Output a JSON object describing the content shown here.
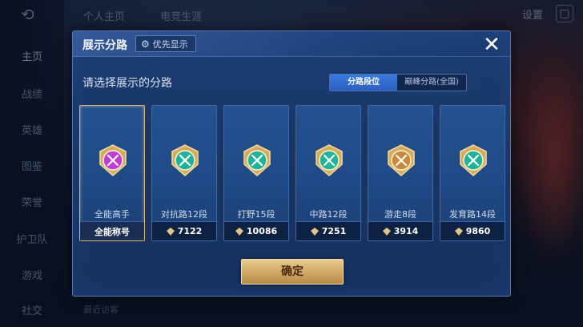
{
  "background": {
    "nav_items": [
      "主页",
      "战绩",
      "英雄",
      "图鉴",
      "荣誉",
      "护卫队",
      "游戏",
      "社交"
    ],
    "top_tabs": [
      "个人主页",
      "电竞生涯"
    ],
    "settings_label": "设置",
    "bottom_left": "最近访客"
  },
  "modal": {
    "title": "展示分路",
    "priority_label": "优先显示",
    "subtitle": "请选择展示的分路",
    "toggle": [
      "分路段位",
      "巅峰分路(全国)"
    ],
    "confirm_label": "确定",
    "cards": [
      {
        "name": "全能高手",
        "value": "全能称号",
        "color": "#c23bd6"
      },
      {
        "name": "对抗路12段",
        "value": "7122",
        "color": "#1fb49a"
      },
      {
        "name": "打野15段",
        "value": "10086",
        "color": "#1fb49a"
      },
      {
        "name": "中路12段",
        "value": "7251",
        "color": "#1fb49a"
      },
      {
        "name": "游走8段",
        "value": "3914",
        "color": "#c9893a"
      },
      {
        "name": "发育路14段",
        "value": "9860",
        "color": "#1fb49a"
      }
    ]
  },
  "colors": {
    "accent_gold": "#d9b77d",
    "toggle_active": "#3a7ae0"
  }
}
